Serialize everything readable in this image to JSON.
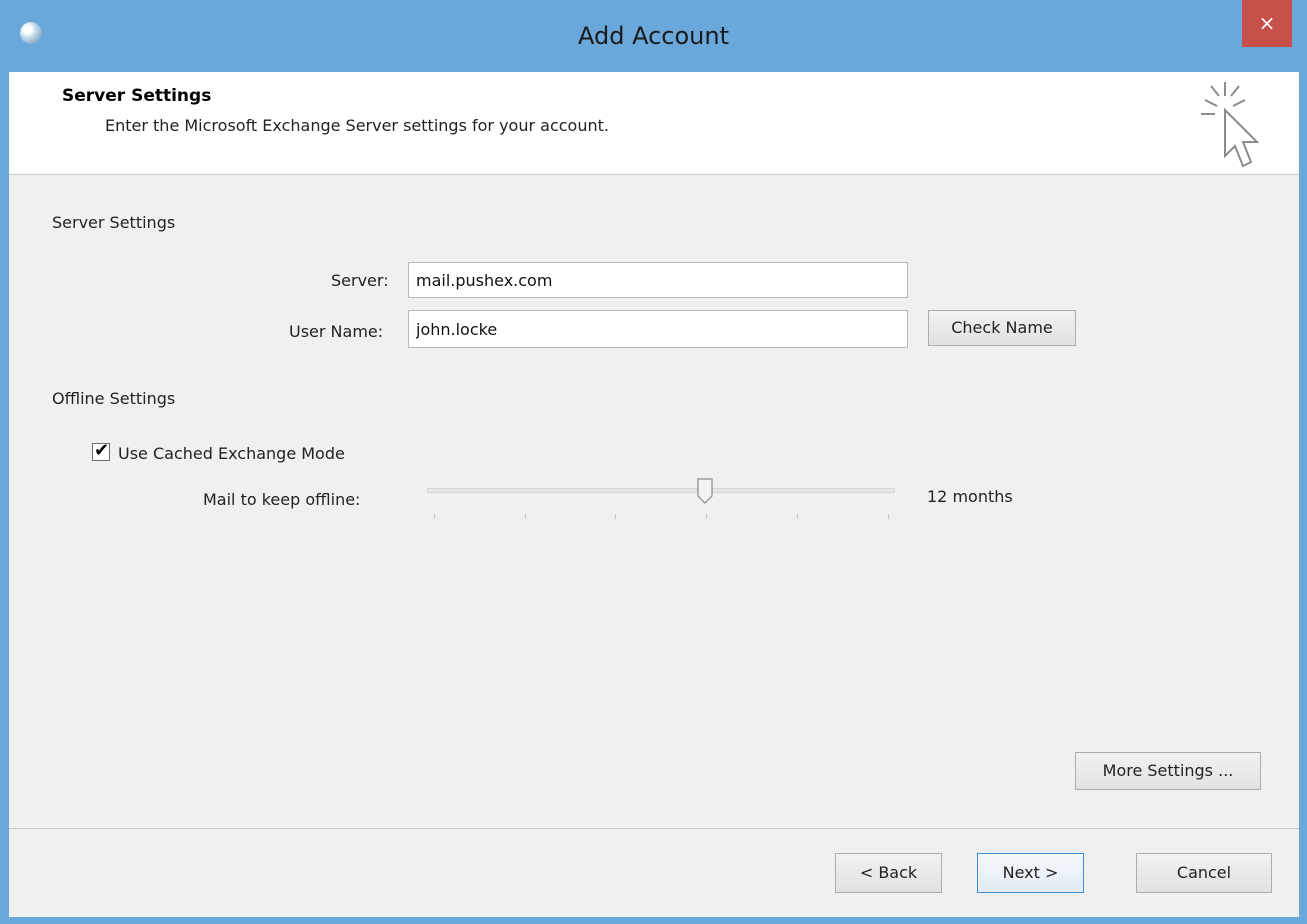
{
  "window": {
    "title": "Add Account",
    "close_label": "×"
  },
  "header": {
    "title": "Server Settings",
    "subtitle": "Enter the Microsoft Exchange Server settings for your account."
  },
  "server_section": {
    "heading": "Server Settings",
    "server_label": "Server:",
    "server_value": "mail.pushex.com",
    "username_label": "User Name:",
    "username_value": "john.locke",
    "check_name_label": "Check Name"
  },
  "offline_section": {
    "heading": "Offline Settings",
    "cached_mode_label": "Use Cached Exchange Mode",
    "cached_mode_checked": true,
    "mail_keep_label": "Mail to keep offline:",
    "mail_keep_value": "12 months",
    "slider_level_fraction": 0.6
  },
  "buttons": {
    "more_settings": "More Settings ...",
    "back": "< Back",
    "next": "Next >",
    "cancel": "Cancel"
  },
  "colors": {
    "titlebar": "#6aa8dc",
    "close": "#c7504a",
    "client": "#f0f0f0"
  },
  "icons": [
    "app-icon",
    "close-icon",
    "wizard-cursor-icon",
    "checkmark-icon",
    "slider-thumb-icon"
  ]
}
